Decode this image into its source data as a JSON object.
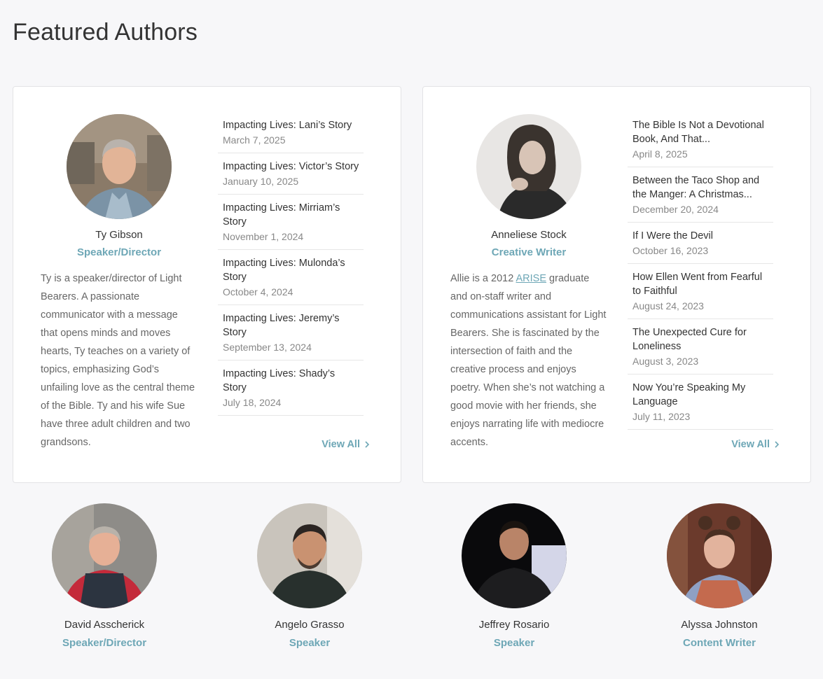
{
  "page": {
    "title": "Featured Authors"
  },
  "featured": [
    {
      "name": "Ty Gibson",
      "role": "Speaker/Director",
      "bio": "Ty is a speaker/director of Light Bearers. A passionate communicator with a message that opens minds and moves hearts, Ty teaches on a variety of topics, emphasizing God’s unfailing love as the central theme of the Bible. Ty and his wife Sue have three adult children and two grandsons.",
      "articles": [
        {
          "title": "Impacting Lives: Lani’s Story",
          "date": "March 7, 2025"
        },
        {
          "title": "Impacting Lives: Victor’s Story",
          "date": "January 10, 2025"
        },
        {
          "title": "Impacting Lives: Mirriam’s Story",
          "date": "November 1, 2024"
        },
        {
          "title": "Impacting Lives: Mulonda’s Story",
          "date": "October 4, 2024"
        },
        {
          "title": "Impacting Lives: Jeremy’s Story",
          "date": "September 13, 2024"
        },
        {
          "title": "Impacting Lives: Shady’s Story",
          "date": "July 18, 2024"
        }
      ],
      "view_all": "View All"
    },
    {
      "name": "Anneliese Stock",
      "role": "Creative Writer",
      "bio_before": "Allie is a 2012 ",
      "bio_link": "ARISE",
      "bio_after": " graduate and on-staff writer and communications assistant for Light Bearers. She is fascinated by the intersection of faith and the creative process and enjoys poetry. When she’s not watching a good movie with her friends, she enjoys narrating life with mediocre accents.",
      "articles": [
        {
          "title": "The Bible Is Not a Devotional Book, And That...",
          "date": "April 8, 2025"
        },
        {
          "title": "Between the Taco Shop and the Manger: A Christmas...",
          "date": "December 20, 2024"
        },
        {
          "title": "If I Were the Devil",
          "date": "October 16, 2023"
        },
        {
          "title": "How Ellen Went from Fearful to Faithful",
          "date": "August 24, 2023"
        },
        {
          "title": "The Unexpected Cure for Loneliness",
          "date": "August 3, 2023"
        },
        {
          "title": "Now You’re Speaking My Language",
          "date": "July 11, 2023"
        }
      ],
      "view_all": "View All"
    }
  ],
  "others": [
    {
      "name": "David Asscherick",
      "role": "Speaker/Director"
    },
    {
      "name": "Angelo Grasso",
      "role": "Speaker"
    },
    {
      "name": "Jeffrey Rosario",
      "role": "Speaker"
    },
    {
      "name": "Alyssa Johnston",
      "role": "Content Writer"
    }
  ],
  "colors": {
    "accent": "#6ea7b6",
    "background": "#f7f7f9"
  }
}
